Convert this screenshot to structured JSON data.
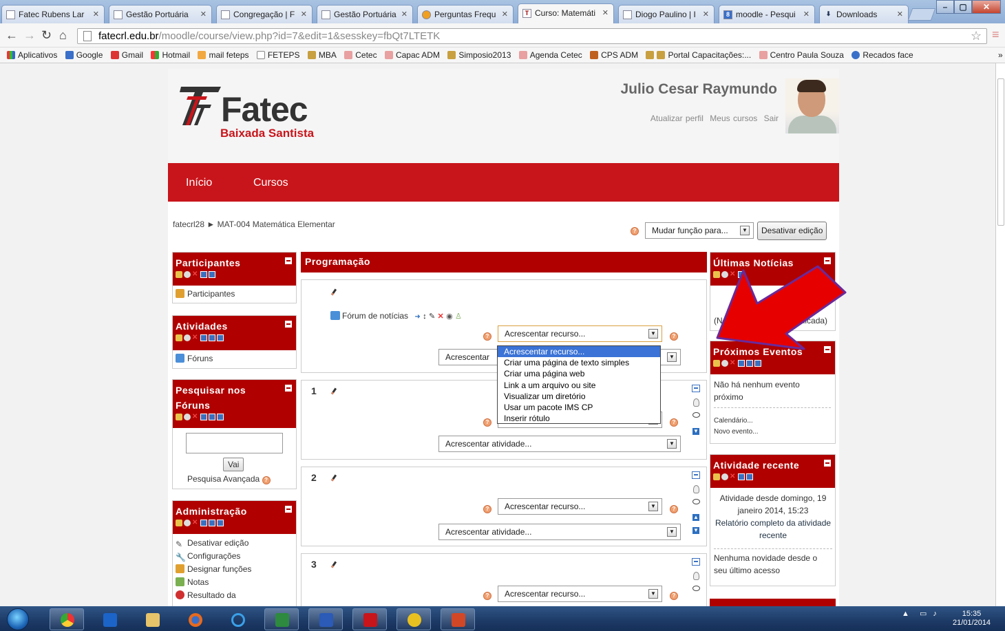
{
  "browser": {
    "tabs": [
      {
        "title": "Fatec Rubens Lar"
      },
      {
        "title": "Gestão Portuária"
      },
      {
        "title": "Congregação | F"
      },
      {
        "title": "Gestão Portuária"
      },
      {
        "title": "Perguntas Frequ"
      },
      {
        "title": "Curso: Matemáti"
      },
      {
        "title": "Diogo Paulino | I"
      },
      {
        "title": "moodle - Pesqui"
      },
      {
        "title": "Downloads"
      }
    ],
    "url_host": "fatecrl.edu.br",
    "url_path": "/moodle/course/view.php?id=7&edit=1&sesskey=fbQt7LTETK",
    "bookmarks": [
      "Aplicativos",
      "Google",
      "Gmail",
      "Hotmail",
      "mail feteps",
      "FETEPS",
      "MBA",
      "Cetec",
      "Capac ADM",
      "Simposio2013",
      "Agenda Cetec",
      "CPS ADM",
      "Portal Capacitações:...",
      "Centro Paula Souza",
      "Recados face"
    ],
    "more_bookmarks": "»"
  },
  "site": {
    "logo_text": "Fatec",
    "logo_sub": "Baixada Santista",
    "user_name": "Julio Cesar Raymundo",
    "user_links": [
      "Atualizar perfil",
      "Meus cursos",
      "Sair"
    ],
    "nav": [
      "Início",
      "Cursos"
    ],
    "breadcrumb_home": "fatecrl28",
    "breadcrumb_sep": "►",
    "breadcrumb_course": "MAT-004 Matemática Elementar",
    "role_select": "Mudar função para...",
    "toggle_edit": "Desativar edição"
  },
  "left_blocks": {
    "participants": {
      "title": "Participantes",
      "items": [
        "Participantes"
      ]
    },
    "activities": {
      "title": "Atividades",
      "items": [
        "Fóruns"
      ]
    },
    "search": {
      "title": "Pesquisar nos Fóruns",
      "button": "Vai",
      "advanced": "Pesquisa Avançada"
    },
    "admin": {
      "title": "Administração",
      "items": [
        "Desativar edição",
        "Configurações",
        "Designar funções",
        "Notas",
        "Resultado da"
      ]
    }
  },
  "main": {
    "title": "Programação",
    "forum_link": "Fórum de notícias",
    "add_resource": "Acrescentar recurso...",
    "add_activity": "Acrescentar atividade...",
    "add_activity_partial": "Acrescentar",
    "sections": [
      "1",
      "2",
      "3"
    ],
    "dropdown_options": [
      "Acrescentar recurso...",
      "Criar uma página de texto simples",
      "Criar uma página web",
      "Link a um arquivo ou site",
      "Visualizar um diretório",
      "Usar um pacote IMS CP",
      "Inserir rótulo"
    ]
  },
  "right_blocks": {
    "news": {
      "title": "Últimas Notícias",
      "line1": "novo",
      "line2": "(Ne",
      "line3": "cia publicada)"
    },
    "events": {
      "title": "Próximos Eventos",
      "text": "Não há nenhum evento próximo",
      "link1": "Calendário...",
      "link2": "Novo evento..."
    },
    "recent": {
      "title": "Atividade recente",
      "since": "Atividade desde domingo, 19 janeiro 2014, 15:23",
      "report": "Relatório completo da atividade recente",
      "none": "Nenhuma novidade desde o seu último acesso"
    }
  },
  "taskbar": {
    "time": "15:35",
    "date": "21/01/2014"
  },
  "colors": {
    "brand_red": "#c8151b",
    "block_red": "#b00000",
    "selection_blue": "#3b73d6"
  }
}
